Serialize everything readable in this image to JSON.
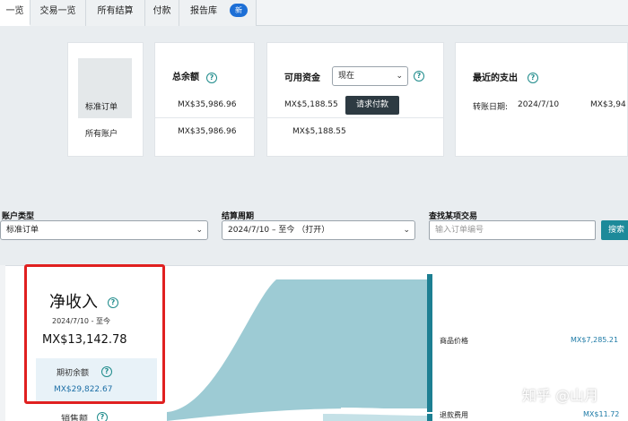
{
  "tabs": [
    {
      "label": "一览",
      "active": true
    },
    {
      "label": "交易一览",
      "active": false
    },
    {
      "label": "所有结算",
      "active": false
    },
    {
      "label": "付款",
      "active": false
    },
    {
      "label": "报告库",
      "active": false
    }
  ],
  "new_badge": "新",
  "summary": {
    "row_labels": [
      "标准订单",
      "所有账户"
    ],
    "total_balance": {
      "title": "总余额",
      "standard": "MX$35,986.96",
      "all": "MX$35,986.96"
    },
    "available_funds": {
      "title": "可用资金",
      "select_value": "现在",
      "standard": "MX$5,188.55",
      "all": "MX$5,188.55",
      "request_button": "请求付款"
    },
    "recent_spend": {
      "title": "最近的支出",
      "transfer_label": "转账日期:",
      "transfer_date": "2024/7/10",
      "amount_partial": "MX$3,94"
    }
  },
  "filters": {
    "account_type": {
      "label": "账户类型",
      "value": "标准订单"
    },
    "settlement_period": {
      "label": "结算周期",
      "value": "2024/7/10 – 至今 （打开）"
    },
    "find_transaction": {
      "label": "查找某项交易",
      "placeholder": "输入订单编号",
      "button": "搜索"
    }
  },
  "net_income": {
    "title": "净收入",
    "period": "2024/7/10 - 至今",
    "amount": "MX$13,142.78",
    "opening_balance_label": "期初余额",
    "opening_balance": "MX$29,822.67",
    "sales_label": "销售额"
  },
  "flow_legend": [
    {
      "label": "商品价格",
      "value": "MX$7,285.21"
    },
    {
      "label": "退款费用",
      "value": "MX$11.72"
    }
  ],
  "watermark": "知乎 @山月",
  "colors": {
    "accent": "#1d8a9a",
    "flow": "#9dcbd4",
    "highlight": "#e02020"
  }
}
